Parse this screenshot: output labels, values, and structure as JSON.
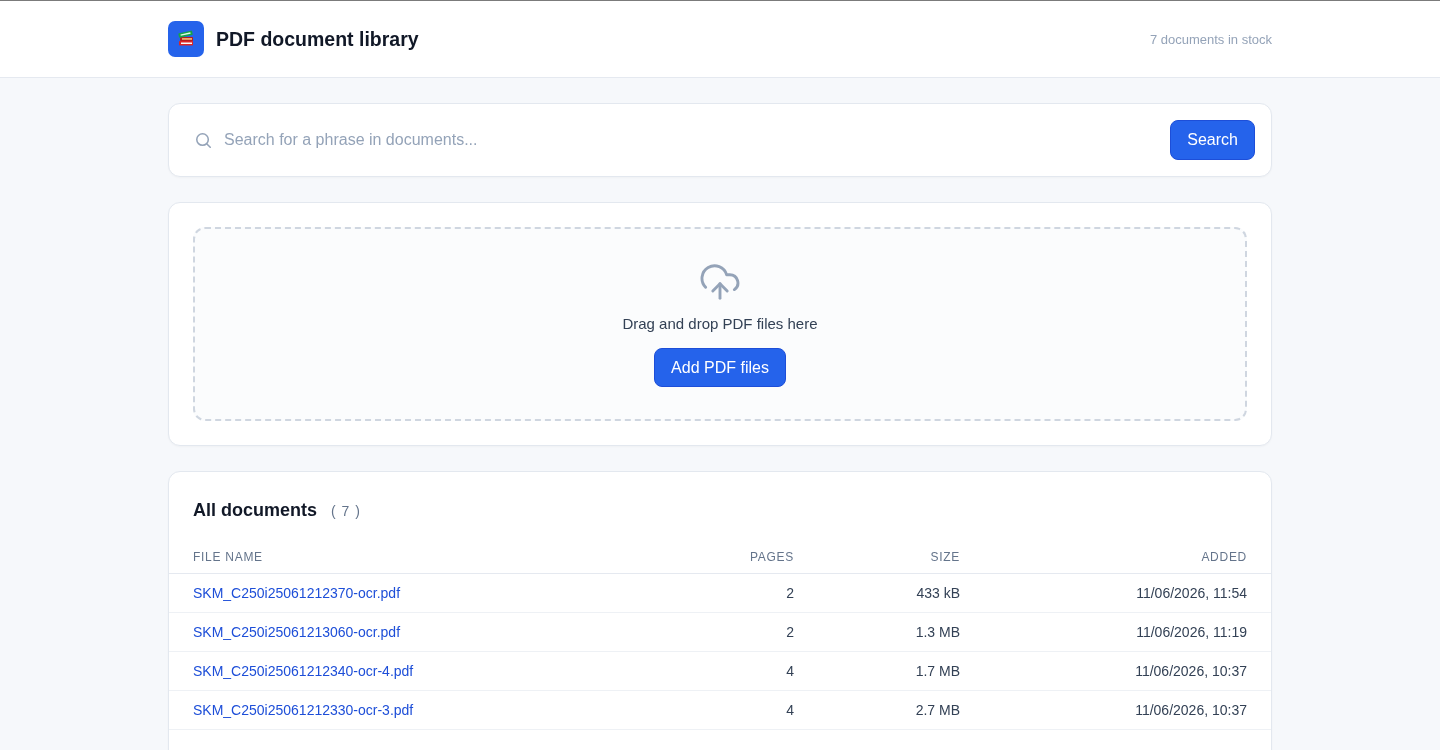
{
  "header": {
    "title": "PDF document library",
    "stock_note": "7 documents in stock"
  },
  "search": {
    "placeholder": "Search for a phrase in documents...",
    "button": "Search"
  },
  "upload": {
    "prompt": "Drag and drop PDF files here",
    "button": "Add PDF files"
  },
  "documents": {
    "title": "All documents",
    "count": "( 7 )",
    "columns": [
      "FILE NAME",
      "PAGES",
      "SIZE",
      "ADDED"
    ],
    "rows": [
      {
        "file_name": "SKM_C250i25061212370-ocr.pdf",
        "pages": "2",
        "size": "433 kB",
        "added": "11/06/2026, 11:54"
      },
      {
        "file_name": "SKM_C250i25061213060-ocr.pdf",
        "pages": "2",
        "size": "1.3 MB",
        "added": "11/06/2026, 11:19"
      },
      {
        "file_name": "SKM_C250i25061212340-ocr-4.pdf",
        "pages": "4",
        "size": "1.7 MB",
        "added": "11/06/2026, 10:37"
      },
      {
        "file_name": "SKM_C250i25061212330-ocr-3.pdf",
        "pages": "4",
        "size": "2.7 MB",
        "added": "11/06/2026, 10:37"
      }
    ]
  }
}
